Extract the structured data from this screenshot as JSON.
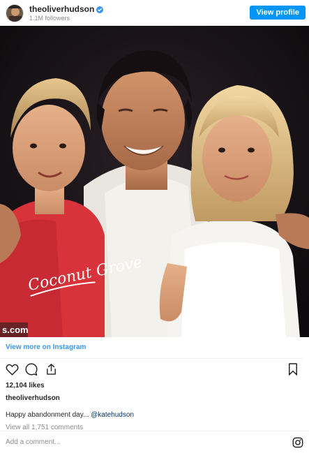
{
  "header": {
    "username": "theoliverhudson",
    "followers": "1.1M followers",
    "view_profile_label": "View profile"
  },
  "photo": {
    "watermark": "s.com",
    "shirt_text": "Coconut Grove"
  },
  "footer": {
    "view_more_label": "View more on Instagram",
    "likes": "12,104 likes",
    "caption_username": "theoliverhudson",
    "caption_text": "Happy abandonment day...",
    "caption_mention": "@katehudson",
    "view_all_comments": "View all 1,751 comments",
    "add_comment_placeholder": "Add a comment..."
  },
  "colors": {
    "accent": "#0095f6",
    "link": "#3897f0",
    "mention": "#003569",
    "secondary_text": "#8e8e8e"
  },
  "icons": [
    "heart-icon",
    "comment-icon",
    "share-icon",
    "bookmark-icon",
    "instagram-logo-icon",
    "verified-badge-icon"
  ]
}
